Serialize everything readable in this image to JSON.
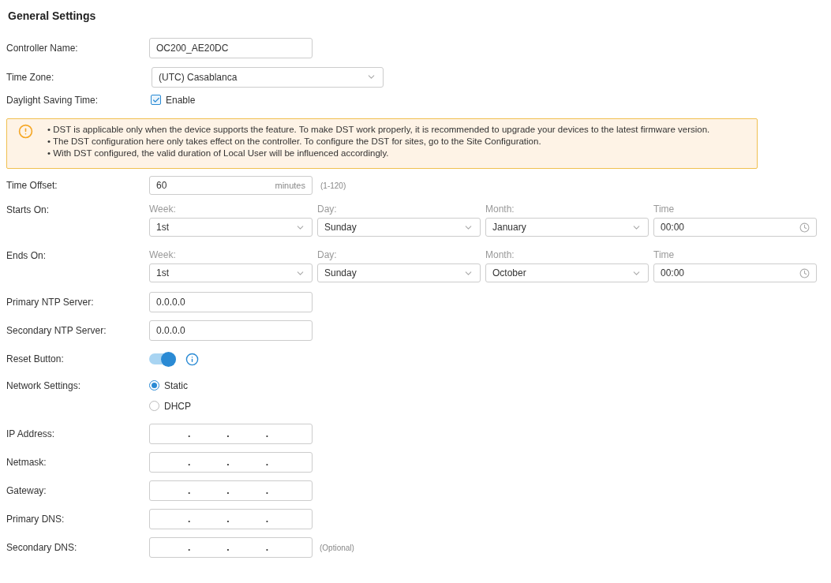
{
  "title": "General Settings",
  "rows": [
    {
      "kind": "text",
      "label": "Controller Name:",
      "value": "OC200_AE20DC"
    },
    {
      "kind": "select",
      "label": "Time Zone:",
      "value": "(UTC) Casablanca"
    },
    {
      "kind": "checkbox",
      "label": "Daylight Saving Time:",
      "option": "Enable",
      "checked": true
    },
    {
      "kind": "alert",
      "lines": [
        "• DST is applicable only when the device supports the feature. To make DST work properly, it is recommended to upgrade your devices to the latest firmware version.",
        "• The DST configuration here only takes effect on the controller. To configure the DST for sites, go to the Site Configuration.",
        "• With DST configured, the valid duration of Local User will be influenced accordingly."
      ]
    },
    {
      "kind": "offset",
      "label": "Time Offset:",
      "value": "60",
      "unit": "minutes",
      "hint": "(1-120)"
    },
    {
      "kind": "dst_rule",
      "label": "Starts On:",
      "parts": [
        {
          "caption": "Week:",
          "value": "1st",
          "kind": "select"
        },
        {
          "caption": "Day:",
          "value": "Sunday",
          "kind": "select"
        },
        {
          "caption": "Month:",
          "value": "January",
          "kind": "select"
        },
        {
          "caption": "Time",
          "value": "00:00",
          "kind": "time"
        }
      ]
    },
    {
      "kind": "dst_rule",
      "label": "Ends On:",
      "parts": [
        {
          "caption": "Week:",
          "value": "1st",
          "kind": "select"
        },
        {
          "caption": "Day:",
          "value": "Sunday",
          "kind": "select"
        },
        {
          "caption": "Month:",
          "value": "October",
          "kind": "select"
        },
        {
          "caption": "Time",
          "value": "00:00",
          "kind": "time"
        }
      ]
    },
    {
      "kind": "text",
      "label": "Primary NTP Server:",
      "value": "0.0.0.0"
    },
    {
      "kind": "text",
      "label": "Secondary NTP Server:",
      "value": "0.0.0.0"
    },
    {
      "kind": "toggle",
      "label": "Reset Button:",
      "on": true
    },
    {
      "kind": "radio",
      "label": "Network Settings:",
      "options": [
        {
          "label": "Static",
          "selected": true
        },
        {
          "label": "DHCP",
          "selected": false
        }
      ]
    },
    {
      "kind": "ip",
      "label": "IP Address:",
      "dots": [
        ".",
        ".",
        "."
      ]
    },
    {
      "kind": "ip",
      "label": "Netmask:",
      "dots": [
        ".",
        ".",
        "."
      ]
    },
    {
      "kind": "ip",
      "label": "Gateway:",
      "dots": [
        ".",
        ".",
        "."
      ]
    },
    {
      "kind": "ip",
      "label": "Primary DNS:",
      "dots": [
        ".",
        ".",
        "."
      ]
    },
    {
      "kind": "ip",
      "label": "Secondary DNS:",
      "dots": [
        ".",
        ".",
        "."
      ],
      "hint": "(Optional)"
    }
  ]
}
